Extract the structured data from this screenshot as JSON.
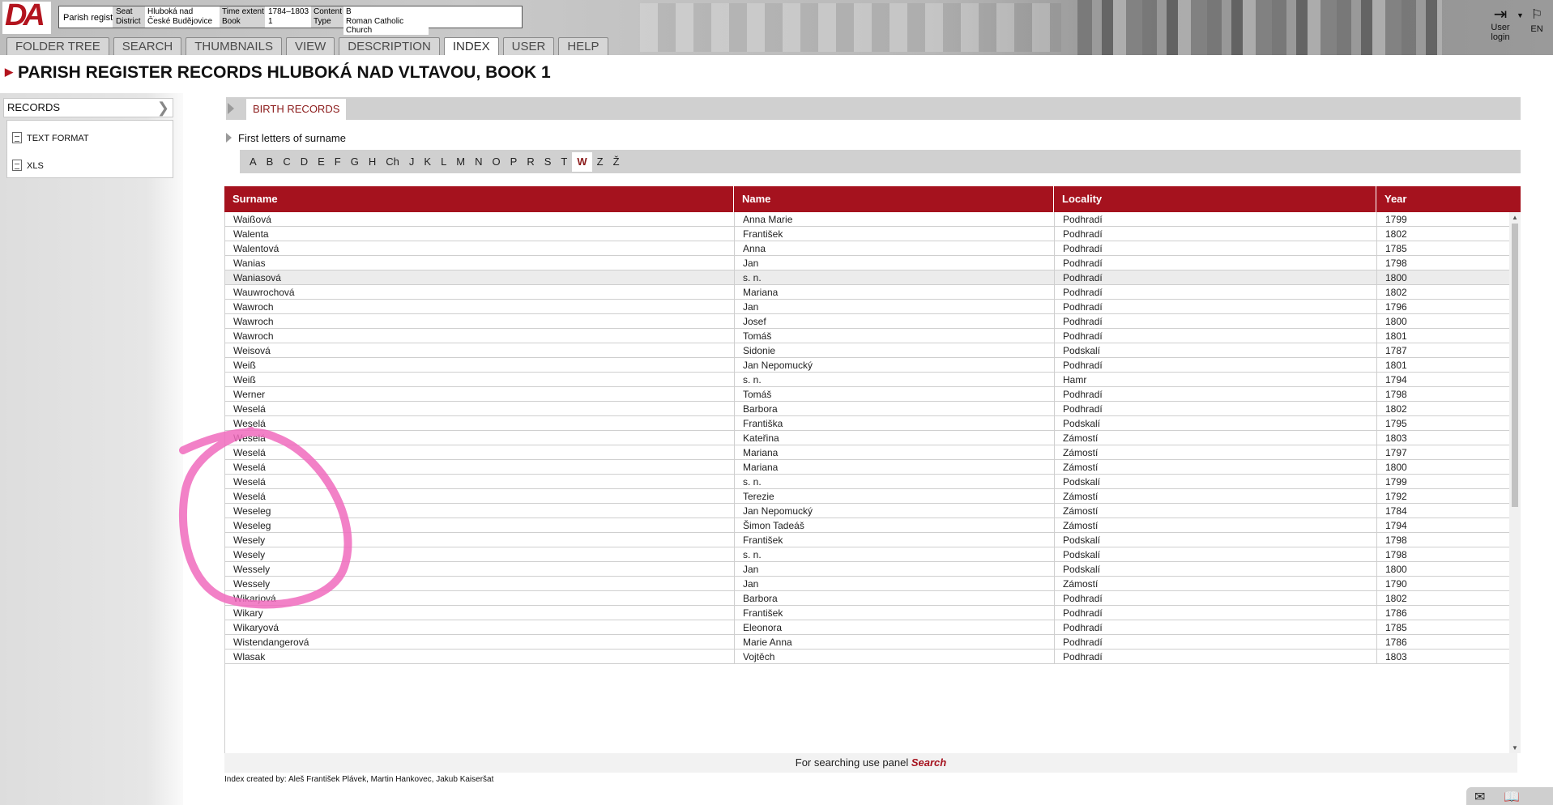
{
  "header": {
    "logo_text": "DA",
    "parish_registers": "Parish registers",
    "info": {
      "seat_label": "Seat",
      "seat_value": "Hluboká nad Vltavou",
      "district_label": "District",
      "district_value": "České Budějovice",
      "time_label": "Time extent",
      "time_value": "1784–1803",
      "book_label": "Book",
      "book_value": "1",
      "content_label": "Content",
      "content_value": "B",
      "type_label": "Type",
      "type_value": "Roman Catholic Church"
    },
    "nav": [
      "FOLDER TREE",
      "SEARCH",
      "THUMBNAILS",
      "VIEW",
      "DESCRIPTION",
      "INDEX",
      "USER",
      "HELP"
    ],
    "active_nav": "INDEX",
    "user_login": "User login",
    "lang": "EN"
  },
  "page_title": "PARISH REGISTER RECORDS HLUBOKÁ NAD VLTAVOU, BOOK 1",
  "sidebar": {
    "head": "RECORDS",
    "items": [
      "TEXT FORMAT",
      "XLS"
    ]
  },
  "main": {
    "tab": "BIRTH RECORDS",
    "first_letters_label": "First letters of surname",
    "letters": [
      "A",
      "B",
      "C",
      "D",
      "E",
      "F",
      "G",
      "H",
      "Ch",
      "J",
      "K",
      "L",
      "M",
      "N",
      "O",
      "P",
      "R",
      "S",
      "T",
      "W",
      "Z",
      "Ž"
    ],
    "active_letter": "W",
    "columns": [
      "Surname",
      "Name",
      "Locality",
      "Year"
    ],
    "rows": [
      [
        "Waißová",
        "Anna Marie",
        "Podhradí",
        "1799"
      ],
      [
        "Walenta",
        "František",
        "Podhradí",
        "1802"
      ],
      [
        "Walentová",
        "Anna",
        "Podhradí",
        "1785"
      ],
      [
        "Wanias",
        "Jan",
        "Podhradí",
        "1798"
      ],
      [
        "Waniasová",
        "s. n.",
        "Podhradí",
        "1800"
      ],
      [
        "Wauwrochová",
        "Mariana",
        "Podhradí",
        "1802"
      ],
      [
        "Wawroch",
        "Jan",
        "Podhradí",
        "1796"
      ],
      [
        "Wawroch",
        "Josef",
        "Podhradí",
        "1800"
      ],
      [
        "Wawroch",
        "Tomáš",
        "Podhradí",
        "1801"
      ],
      [
        "Weisová",
        "Sidonie",
        "Podskalí",
        "1787"
      ],
      [
        "Weiß",
        "Jan Nepomucký",
        "Podhradí",
        "1801"
      ],
      [
        "Weiß",
        "s. n.",
        "Hamr",
        "1794"
      ],
      [
        "Werner",
        "Tomáš",
        "Podhradí",
        "1798"
      ],
      [
        "Weselá",
        "Barbora",
        "Podhradí",
        "1802"
      ],
      [
        "Weselá",
        "Františka",
        "Podskalí",
        "1795"
      ],
      [
        "Weselá",
        "Kateřina",
        "Zámostí",
        "1803"
      ],
      [
        "Weselá",
        "Mariana",
        "Zámostí",
        "1797"
      ],
      [
        "Weselá",
        "Mariana",
        "Zámostí",
        "1800"
      ],
      [
        "Weselá",
        "s. n.",
        "Podskalí",
        "1799"
      ],
      [
        "Weselá",
        "Terezie",
        "Zámostí",
        "1792"
      ],
      [
        "Weseleg",
        "Jan Nepomucký",
        "Zámostí",
        "1784"
      ],
      [
        "Weseleg",
        "Šimon Tadeáš",
        "Zámostí",
        "1794"
      ],
      [
        "Wesely",
        "František",
        "Podskalí",
        "1798"
      ],
      [
        "Wesely",
        "s. n.",
        "Podskalí",
        "1798"
      ],
      [
        "Wessely",
        "Jan",
        "Podskalí",
        "1800"
      ],
      [
        "Wessely",
        "Jan",
        "Zámostí",
        "1790"
      ],
      [
        "Wikarjová",
        "Barbora",
        "Podhradí",
        "1802"
      ],
      [
        "Wikary",
        "František",
        "Podhradí",
        "1786"
      ],
      [
        "Wikaryová",
        "Eleonora",
        "Podhradí",
        "1785"
      ],
      [
        "Wistendangerová",
        "Marie Anna",
        "Podhradí",
        "1786"
      ],
      [
        "Wlasak",
        "Vojtěch",
        "Podhradí",
        "1803"
      ]
    ],
    "highlighted_row": 4,
    "search_note_prefix": "For searching use panel",
    "search_note_link": "Search",
    "credits": "Index created by: Aleš František Plávek, Martin Hankovec, Jakub Kaiseršat"
  },
  "colors": {
    "accent_red": "#a5121e",
    "annotation_pink": "#f06bbd"
  },
  "icons": {
    "user_login": "login-arrow-icon",
    "lang": "language-icon",
    "mail": "mail-icon",
    "book": "book-icon"
  }
}
